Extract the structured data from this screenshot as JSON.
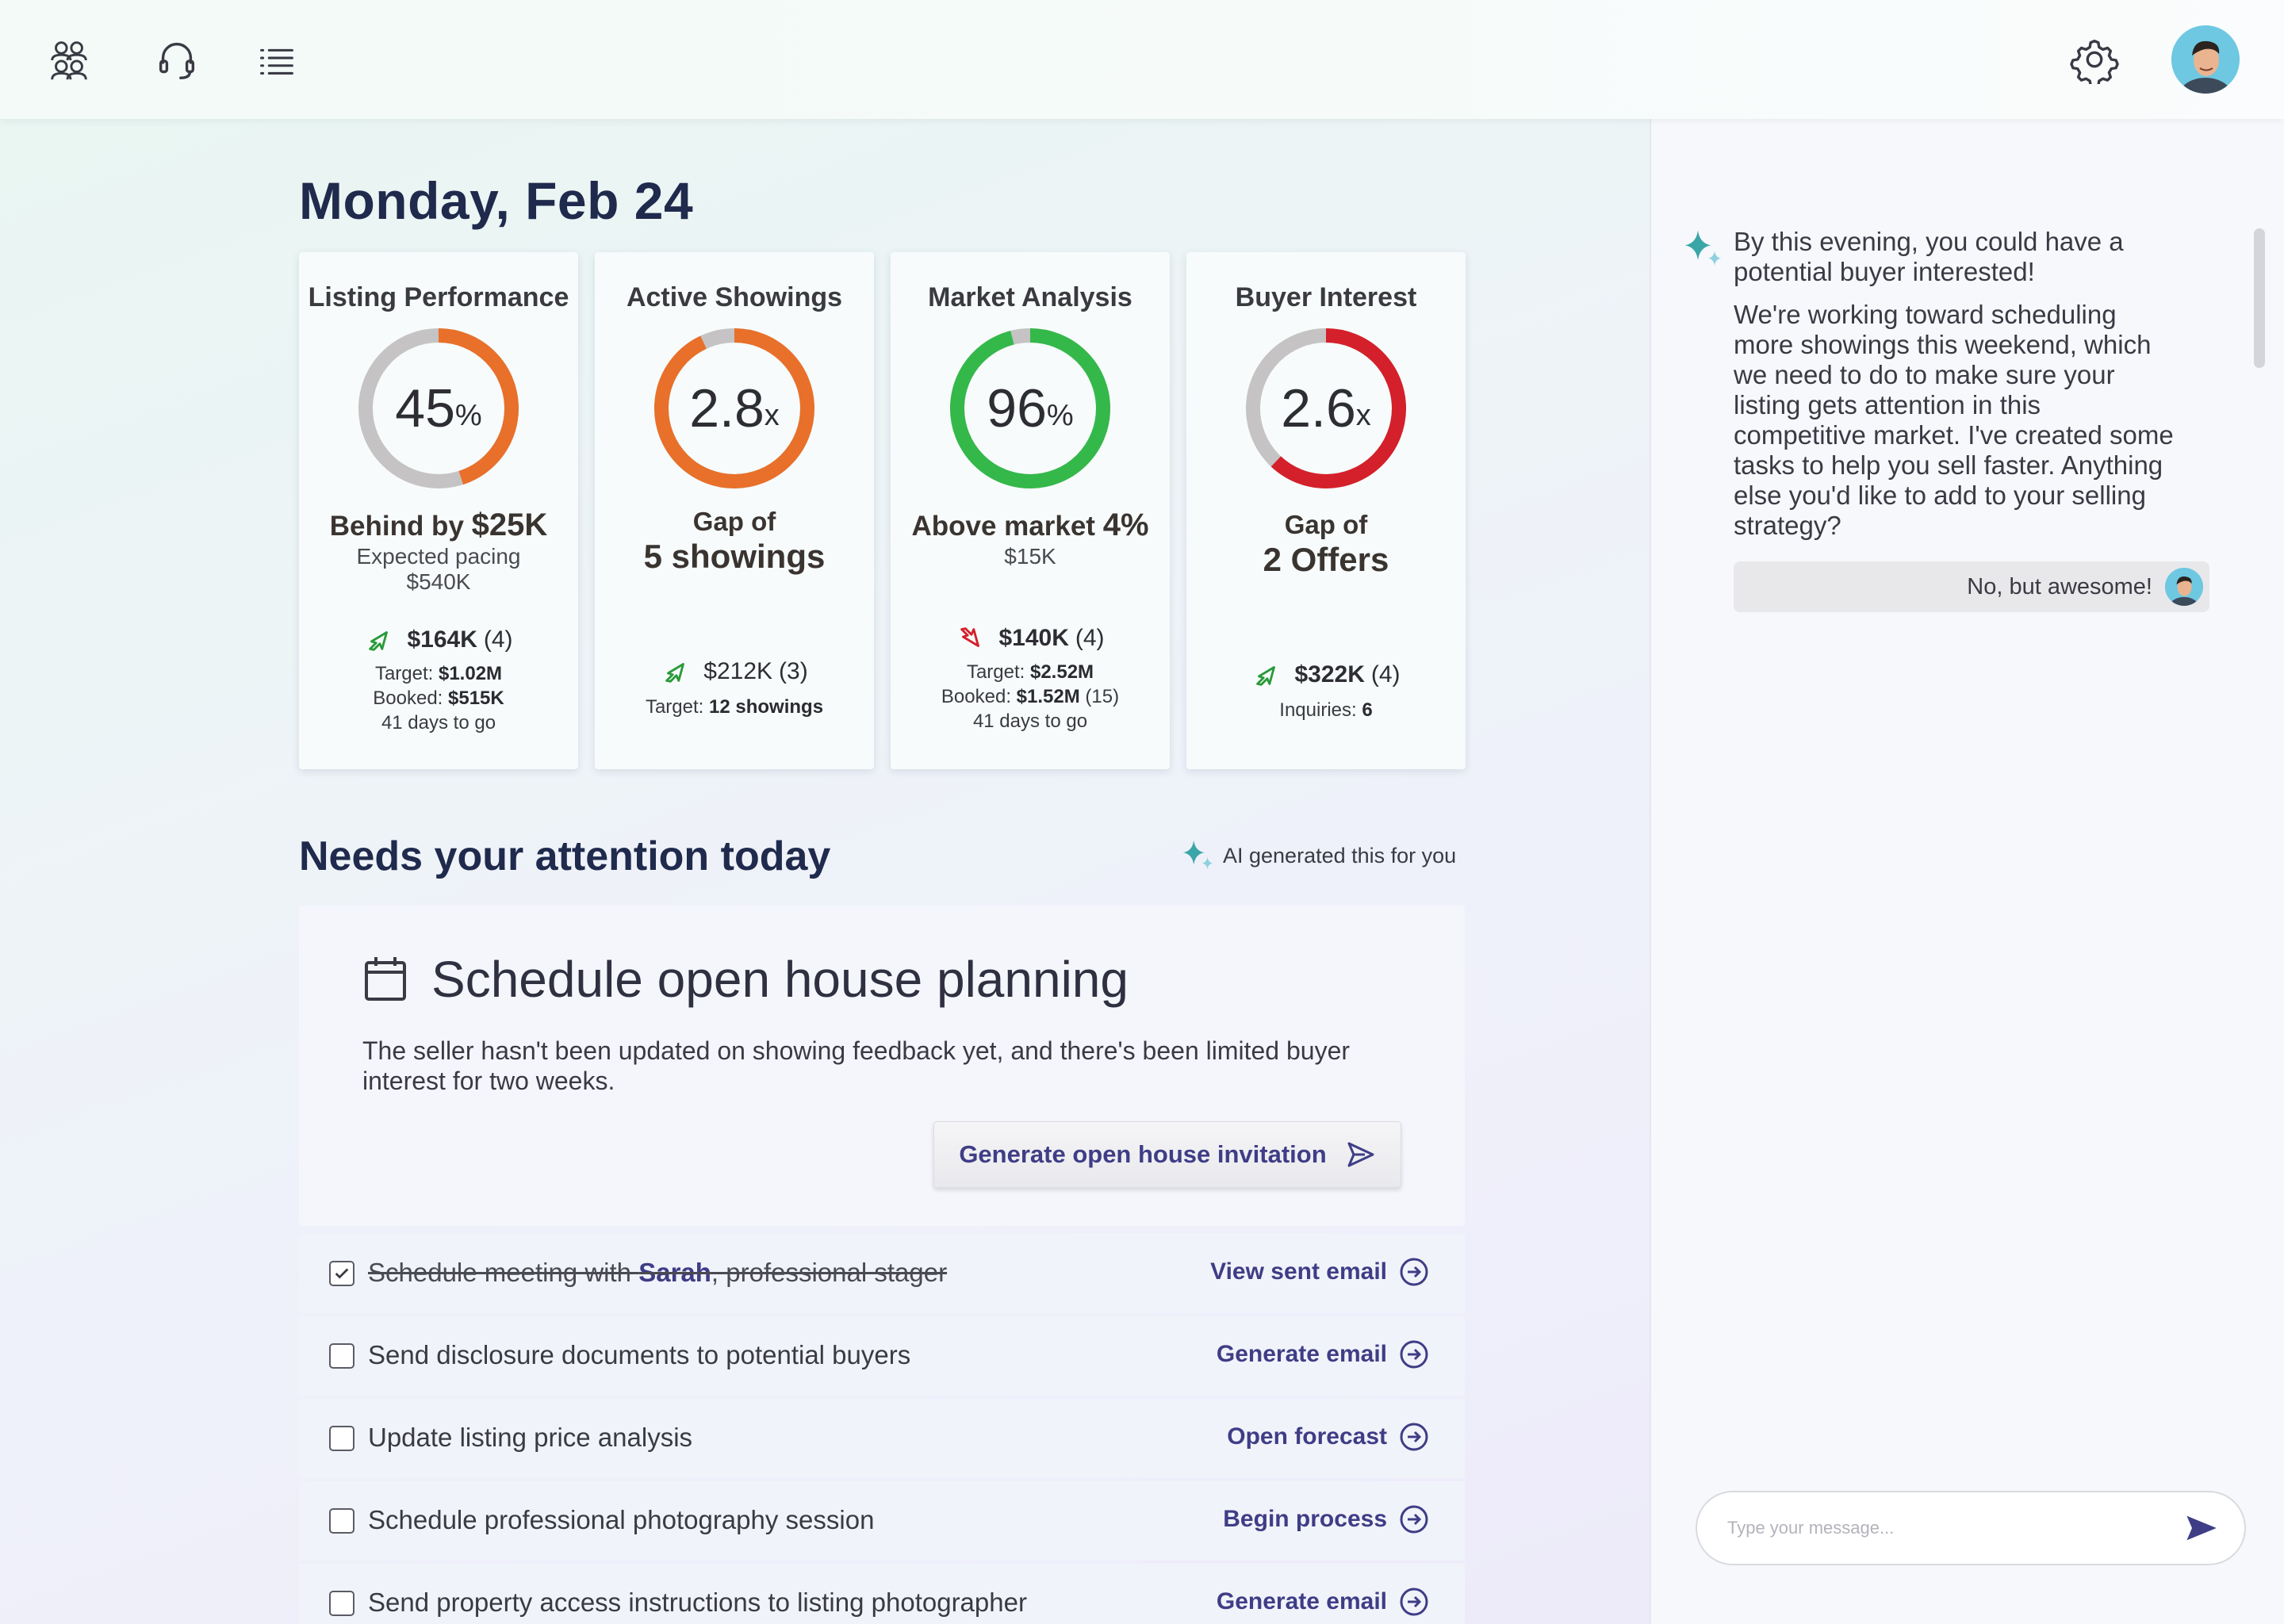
{
  "header": {
    "icons": [
      "team-icon",
      "headset-icon",
      "list-icon",
      "gear-icon",
      "avatar"
    ]
  },
  "page": {
    "date_title": "Monday, Feb 24"
  },
  "kpis": [
    {
      "title": "Listing Performance",
      "value": "45",
      "unit": "%",
      "progress": 0.45,
      "color": "#e8702a",
      "big_prefix": "Behind by ",
      "big_em": "$25K",
      "sub1": "Expected pacing",
      "sub2": "$540K",
      "trend": "up",
      "stat": "$164K",
      "stat_count": "(4)",
      "lines": [
        {
          "label": "Target: ",
          "value": "$1.02M",
          "suffix": ""
        },
        {
          "label": "Booked: ",
          "value": "$515K",
          "suffix": ""
        },
        {
          "label": "41 days to go",
          "value": "",
          "suffix": ""
        }
      ]
    },
    {
      "title": "Active Showings",
      "value": "2.8",
      "unit": "x",
      "progress": 0.93,
      "color": "#e8702a",
      "big_line1": "Gap of",
      "big_line2": "5 showings",
      "trend": "up",
      "stat": "$212K",
      "stat_count": "(3)",
      "lines": [
        {
          "label": "Target: ",
          "value": "12 showings",
          "suffix": ""
        }
      ]
    },
    {
      "title": "Market Analysis",
      "value": "96",
      "unit": "%",
      "progress": 0.96,
      "color": "#34b84a",
      "big_prefix": "Above market ",
      "big_em": "4%",
      "sub1": "$15K",
      "trend": "down",
      "stat": "$140K",
      "stat_count": "(4)",
      "lines": [
        {
          "label": "Target: ",
          "value": "$2.52M",
          "suffix": ""
        },
        {
          "label": "Booked: ",
          "value": "$1.52M",
          "suffix": " (15)"
        },
        {
          "label": "41 days to go",
          "value": "",
          "suffix": ""
        }
      ]
    },
    {
      "title": "Buyer Interest",
      "value": "2.6",
      "unit": "x",
      "progress": 0.62,
      "color": "#d4202a",
      "big_line1": "Gap of",
      "big_line2": "2 Offers",
      "trend": "up",
      "stat": "$322K",
      "stat_count": "(4)",
      "lines": [
        {
          "label": "Inquiries: ",
          "value": "6",
          "suffix": ""
        }
      ]
    }
  ],
  "attention": {
    "title": "Needs your attention today",
    "ai_note": "AI generated this for you"
  },
  "task": {
    "title": "Schedule open house planning",
    "description": "The seller hasn't been updated on showing feedback yet, and there's been limited buyer interest for two weeks.",
    "button_label": "Generate open house invitation"
  },
  "todos": [
    {
      "text_before": "Schedule meeting with ",
      "highlight": "Sarah",
      "text_after": ", professional stager",
      "done": true,
      "action": "View sent email"
    },
    {
      "text_before": "Send disclosure documents to potential buyers",
      "highlight": "",
      "text_after": "",
      "done": false,
      "action": "Generate email"
    },
    {
      "text_before": "Update listing price analysis",
      "highlight": "",
      "text_after": "",
      "done": false,
      "action": "Open forecast"
    },
    {
      "text_before": "Schedule professional photography session",
      "highlight": "",
      "text_after": "",
      "done": false,
      "action": "Begin process"
    },
    {
      "text_before": "Send property access instructions to listing photographer",
      "highlight": "",
      "text_after": "",
      "done": false,
      "action": "Generate email"
    }
  ],
  "chat": {
    "message_lead": "By this evening, you could have a potential buyer interested!",
    "message_body": "We're working toward scheduling more showings this weekend, which we need to do to make sure your listing gets attention in this competitive market. I've created some tasks to help you sell faster. Anything else you'd like to add to your selling strategy?",
    "reply": "No, but awesome!",
    "input_placeholder": "Type your message..."
  },
  "colors": {
    "accent": "#3f3d86",
    "title": "#1f2a4d",
    "orange": "#e8702a",
    "green": "#34b84a",
    "red": "#d4202a",
    "trend_up": "#2a9a3a",
    "trend_down": "#d4202a"
  }
}
